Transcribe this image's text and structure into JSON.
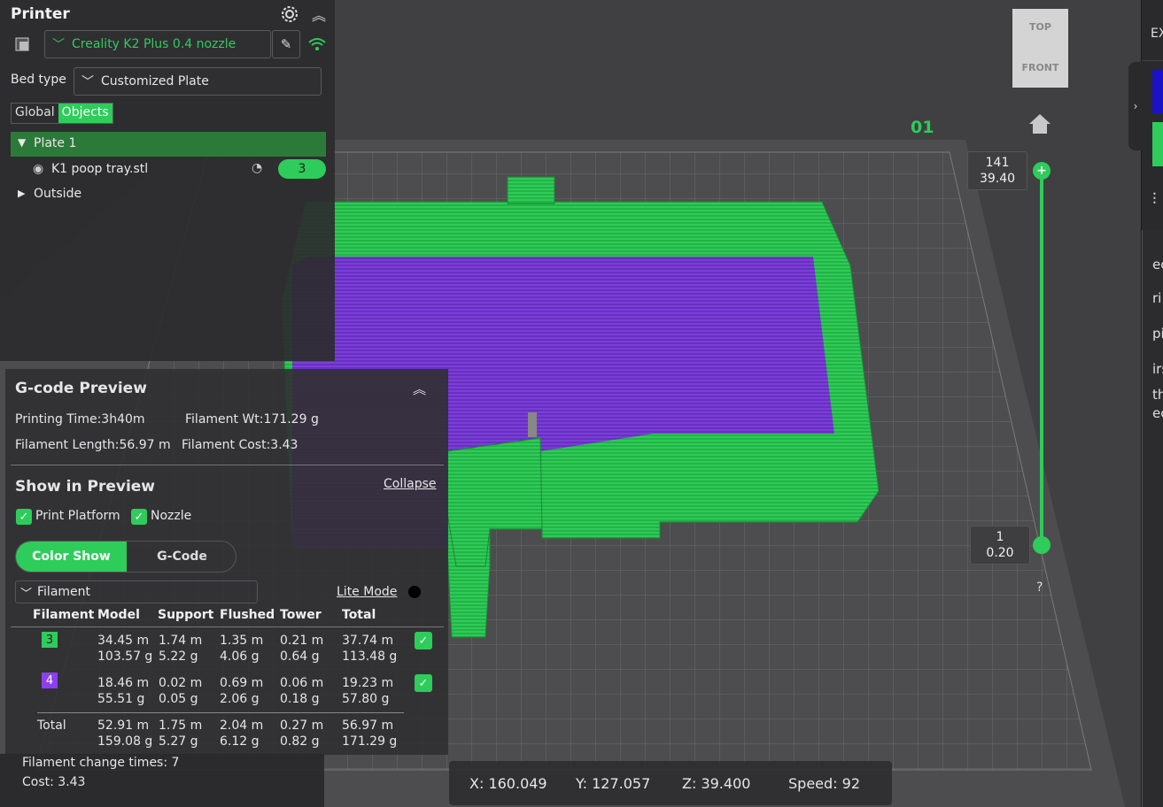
{
  "printer_panel": {
    "title": "Printer",
    "printer_name": "Creality K2 Plus 0.4 nozzle",
    "bed_type_label": "Bed type",
    "bed_type_value": "Customized Plate",
    "tabs": [
      "Global",
      "Objects"
    ],
    "active_tab": "Objects",
    "tree": {
      "plate_label": "Plate 1",
      "object_name": "K1 poop tray.stl",
      "object_badge": "3",
      "outside_label": "Outside"
    }
  },
  "view_cube": {
    "top": "TOP",
    "front": "FRONT"
  },
  "plate_number": "01",
  "layer_slider": {
    "top_layer": "141",
    "top_height": "39.40",
    "bottom_layer": "1",
    "bottom_height": "0.20",
    "help": "?"
  },
  "gcode_panel": {
    "title": "G-code Preview",
    "printing_time": "Printing Time:3h40m",
    "filament_wt": "Filament Wt:171.29 g",
    "filament_length": "Filament Length:56.97 m",
    "filament_cost": "Filament Cost:3.43",
    "show_in_preview": "Show in Preview",
    "collapse": "Collapse",
    "print_platform": "Print Platform",
    "nozzle": "Nozzle",
    "color_show": "Color Show",
    "gcode": "G-Code",
    "filament_dropdown": "Filament",
    "lite_mode": "Lite Mode",
    "headers": [
      "Filament",
      "Model",
      "Support",
      "Flushed",
      "Tower",
      "Total"
    ],
    "rows": [
      {
        "id": "3",
        "color": "#2ecc5a",
        "model": [
          "34.45 m",
          "103.57 g"
        ],
        "support": [
          "1.74 m",
          "5.22 g"
        ],
        "flushed": [
          "1.35 m",
          "4.06 g"
        ],
        "tower": [
          "0.21 m",
          "0.64 g"
        ],
        "total": [
          "37.74 m",
          "113.48 g"
        ]
      },
      {
        "id": "4",
        "color": "#8a3ff0",
        "model": [
          "18.46 m",
          "55.51 g"
        ],
        "support": [
          "0.02 m",
          "0.05 g"
        ],
        "flushed": [
          "0.69 m",
          "2.06 g"
        ],
        "tower": [
          "0.06 m",
          "0.18 g"
        ],
        "total": [
          "19.23 m",
          "57.80 g"
        ]
      }
    ],
    "total_row": {
      "label": "Total",
      "model": [
        "52.91 m",
        "159.08 g"
      ],
      "support": [
        "1.75 m",
        "5.27 g"
      ],
      "flushed": [
        "2.04 m",
        "6.12 g"
      ],
      "tower": [
        "0.27 m",
        "0.82 g"
      ],
      "total": [
        "56.97 m",
        "171.29 g"
      ]
    }
  },
  "bottom_info": {
    "change_times": "Filament change times:  7",
    "cost": "Cost:  3.43"
  },
  "coords": {
    "x": "X: 160.049",
    "y": "Y: 127.057",
    "z": "Z: 39.400",
    "speed": "Speed: 92"
  },
  "right_panel": {
    "top_text": "EX",
    "lines": [
      "ec",
      "ri",
      "pi",
      "irs",
      "th",
      "ec"
    ]
  },
  "colors": {
    "accent": "#2ecc5a",
    "purple": "#7a38d8",
    "bed": "#4a4a4c"
  }
}
